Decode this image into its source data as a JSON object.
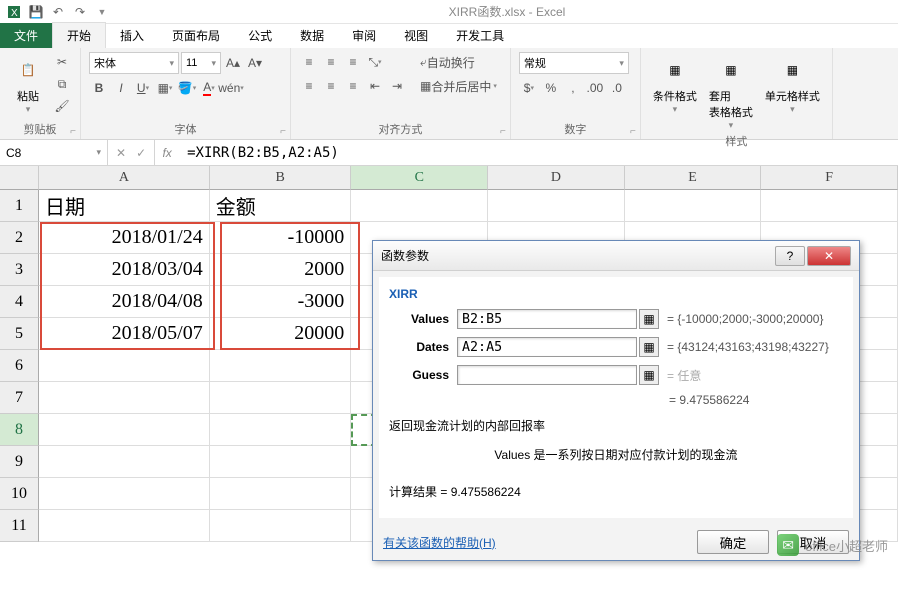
{
  "app": {
    "title": "XIRR函数.xlsx - Excel"
  },
  "tabs": {
    "file": "文件",
    "home": "开始",
    "insert": "插入",
    "pagelayout": "页面布局",
    "formulas": "公式",
    "data": "数据",
    "review": "审阅",
    "view": "视图",
    "developer": "开发工具"
  },
  "ribbon": {
    "paste": "粘贴",
    "clipboard": "剪贴板",
    "font_group": "字体",
    "align_group": "对齐方式",
    "number_group": "数字",
    "styles_group": "样式",
    "font_name": "宋体",
    "font_size": "11",
    "wrap": "自动换行",
    "merge": "合并后居中",
    "general": "常规",
    "cond_fmt": "条件格式",
    "as_table": "套用\n表格格式",
    "cell_styles": "单元格样式"
  },
  "namebox": "C8",
  "formula": "=XIRR(B2:B5,A2:A5)",
  "cols": {
    "A": "A",
    "B": "B",
    "C": "C",
    "D": "D",
    "E": "E",
    "F": "F"
  },
  "col_widths": {
    "A": 175,
    "B": 145,
    "C": 140,
    "D": 140,
    "E": 140,
    "F": 140
  },
  "rows": [
    "1",
    "2",
    "3",
    "4",
    "5",
    "6",
    "7",
    "8",
    "9",
    "10",
    "11"
  ],
  "cells": {
    "A1": "日期",
    "B1": "金额",
    "A2": "2018/01/24",
    "B2": "-10000",
    "A3": "2018/03/04",
    "B3": "2000",
    "A4": "2018/04/08",
    "B4": "-3000",
    "A5": "2018/05/07",
    "B5": "20000"
  },
  "dialog": {
    "title": "函数参数",
    "fn": "XIRR",
    "args": {
      "Values": {
        "label": "Values",
        "value": "B2:B5",
        "eval": "{-10000;2000;-3000;20000}"
      },
      "Dates": {
        "label": "Dates",
        "value": "A2:A5",
        "eval": "{43124;43163;43198;43227}"
      },
      "Guess": {
        "label": "Guess",
        "value": "",
        "eval": "任意"
      }
    },
    "result_inline": "9.475586224",
    "desc": "返回现金流计划的内部回报率",
    "hint": "Values   是一系列按日期对应付款计划的现金流",
    "calc_label": "计算结果 = ",
    "calc_value": "9.475586224",
    "help": "有关该函数的帮助(H)",
    "ok": "确定",
    "cancel": "取消"
  },
  "watermark": "office小超老师"
}
